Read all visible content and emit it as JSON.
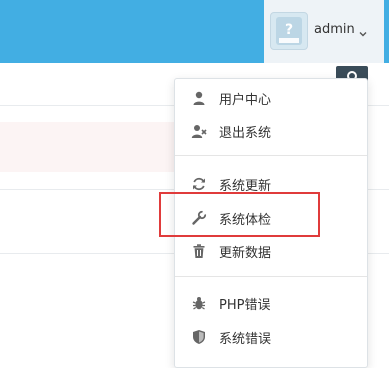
{
  "header": {
    "username": "admin",
    "avatar_icon": "avatar-placeholder-icon",
    "dropdown_icon": "chevron-down-icon"
  },
  "dropdown": {
    "items": [
      {
        "label": "用户中心",
        "icon": "user-icon"
      },
      {
        "label": "退出系统",
        "icon": "user-remove-icon"
      },
      {
        "label": "系统更新",
        "icon": "refresh-icon"
      },
      {
        "label": "系统体检",
        "icon": "wrench-icon"
      },
      {
        "label": "更新数据",
        "icon": "trash-icon"
      },
      {
        "label": "PHP错误",
        "icon": "bug-icon"
      },
      {
        "label": "系统错误",
        "icon": "shield-icon"
      }
    ]
  },
  "colors": {
    "topbar": "#42aee3",
    "highlight_border": "#e03b3b",
    "icon": "#666666"
  }
}
